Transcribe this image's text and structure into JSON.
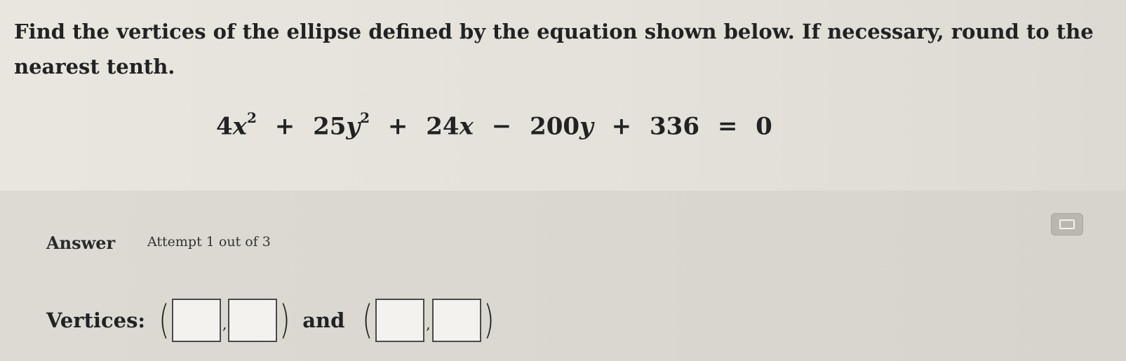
{
  "question": {
    "prompt": "Find the vertices of the ellipse defined by the equation shown below. If necessary, round to the nearest tenth.",
    "equation": {
      "term1_coef": "4",
      "term1_var": "x",
      "term1_exp": "2",
      "op1": "+",
      "term2_coef": "25",
      "term2_var": "y",
      "term2_exp": "2",
      "op2": "+",
      "term3_coef": "24",
      "term3_var": "x",
      "op3": "−",
      "term4_coef": "200",
      "term4_var": "y",
      "op4": "+",
      "constant": "336",
      "equals": "=",
      "rhs": "0"
    }
  },
  "answer": {
    "label": "Answer",
    "attempt_text": "Attempt 1 out of 3",
    "calculator_icon": "calculator-icon",
    "vertices_label": "Vertices:",
    "open_paren": "(",
    "close_paren": ")",
    "comma": ",",
    "and_label": "and",
    "vertex1": {
      "x_value": "",
      "y_value": ""
    },
    "vertex2": {
      "x_value": "",
      "y_value": ""
    }
  },
  "colors": {
    "background": "#e5e2da",
    "answer_panel": "#d9d7cf",
    "input_box": "#f3f2ee",
    "calculator_button": "#b9b7b0"
  }
}
